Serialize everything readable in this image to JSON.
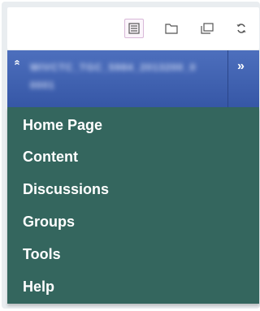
{
  "toolbar": {
    "icons": [
      "list-view-icon",
      "folder-icon",
      "window-icon",
      "refresh-icon"
    ]
  },
  "course": {
    "collapse_glyph": "»",
    "expand_glyph": "»",
    "title": "WIVCTC_TGC_5984_2013200_00001"
  },
  "menu": {
    "items": [
      {
        "label": "Home Page"
      },
      {
        "label": "Content"
      },
      {
        "label": "Discussions"
      },
      {
        "label": "Groups"
      },
      {
        "label": "Tools"
      },
      {
        "label": "Help"
      }
    ]
  },
  "colors": {
    "course_bar": "#3f62b0",
    "menu_background": "#34665e",
    "menu_text": "#ffffff",
    "toolbar_background": "#ffffff"
  }
}
